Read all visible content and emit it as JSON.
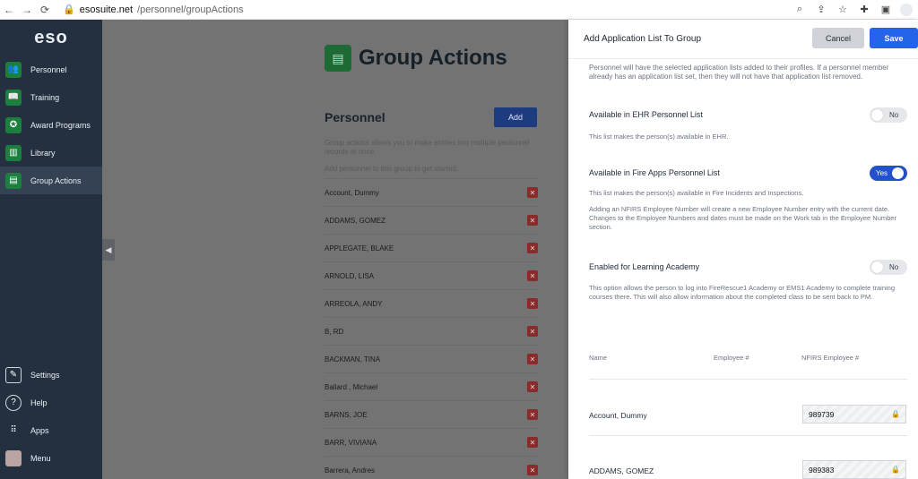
{
  "browser": {
    "url_host": "esosuite.net",
    "url_path": "/personnel/groupActions"
  },
  "sidebar": {
    "logo": "eso",
    "items": [
      {
        "label": "Personnel",
        "icon": "people-icon"
      },
      {
        "label": "Training",
        "icon": "book-icon"
      },
      {
        "label": "Award Programs",
        "icon": "award-icon"
      },
      {
        "label": "Library",
        "icon": "library-icon"
      },
      {
        "label": "Group Actions",
        "icon": "group-actions-icon"
      }
    ],
    "bottom_items": [
      {
        "label": "Settings",
        "icon": "wrench-icon"
      },
      {
        "label": "Help",
        "icon": "help-icon"
      },
      {
        "label": "Apps",
        "icon": "apps-grid-icon"
      },
      {
        "label": "Menu",
        "icon": "avatar"
      }
    ]
  },
  "main": {
    "title": "Group Actions",
    "section_title": "Personnel",
    "add_label": "Add",
    "description": "Group actions allows you to make entries into multiple personnel records at once.",
    "hint": "Add personnel to this group to get started.",
    "personnel": [
      "Account, Dummy",
      "ADDAMS, GOMEZ",
      "APPLEGATE, BLAKE",
      "ARNOLD, LISA",
      "ARREOLA, ANDY",
      "B, RD",
      "BACKMAN, TINA",
      "Ballard , Michael",
      "BARNS, JOE",
      "BARR, VIVIANA",
      "Barrera, Andres"
    ]
  },
  "panel": {
    "title": "Add Application List To Group",
    "cancel_label": "Cancel",
    "save_label": "Save",
    "intro": "Personnel will have the selected application lists added to their profiles. If a personnel member already has an application list set, then they will not have that application list removed.",
    "options": [
      {
        "label": "Available in EHR Personnel List",
        "state": "No",
        "on": false,
        "help": "This list makes the person(s) available in EHR."
      },
      {
        "label": "Available in Fire Apps Personnel List",
        "state": "Yes",
        "on": true,
        "help": "This list makes the person(s) available in Fire Incidents and Inspections.",
        "help2": "Adding an NFIRS Employee Number will create a new Employee Number entry with the current date. Changes to the Employee Numbers and dates must be made on the Work tab in the Employee Number section."
      },
      {
        "label": "Enabled for Learning Academy",
        "state": "No",
        "on": false,
        "help": "This option allows the person to log into FireRescue1 Academy or EMS1 Academy to complete training courses there. This will also allow information about the completed class to be sent back to PM."
      }
    ],
    "columns": {
      "name": "Name",
      "employee": "Employee #",
      "nfirs": "NFIRS Employee #"
    },
    "employees": [
      {
        "name": "Account, Dummy",
        "nfirs": "989739"
      },
      {
        "name": "ADDAMS, GOMEZ",
        "nfirs": "989383"
      }
    ]
  },
  "colors": {
    "sidebar_bg": "#243040",
    "accent_green": "#1b7f3e",
    "save_blue": "#2563eb",
    "remove_red": "#8b2a2a"
  }
}
